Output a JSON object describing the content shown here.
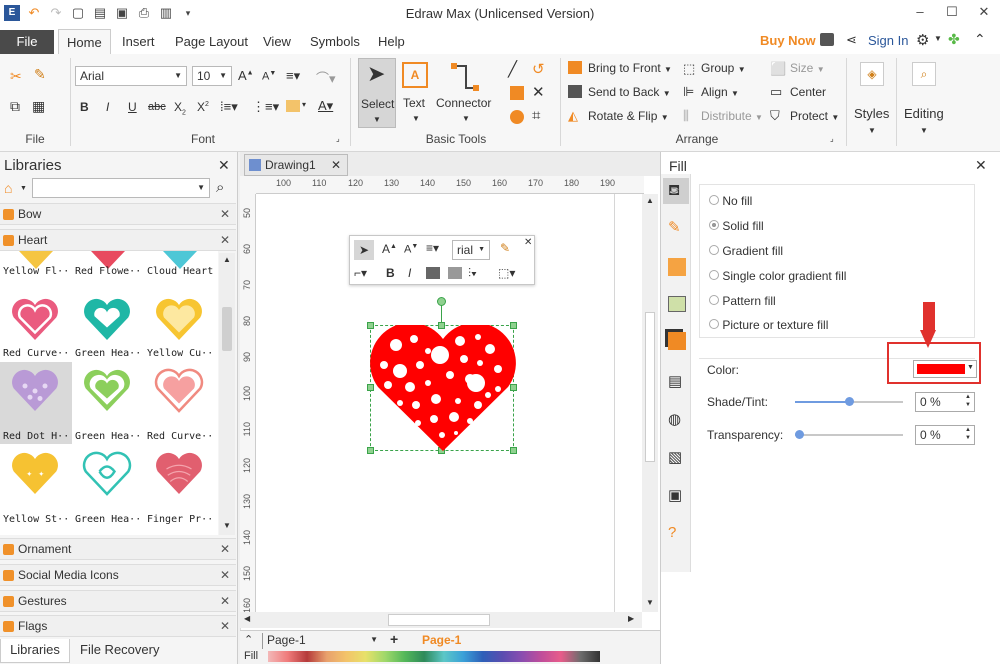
{
  "app": {
    "title": "Edraw Max (Unlicensed Version)"
  },
  "menu": {
    "file": "File",
    "tabs": [
      "Home",
      "Insert",
      "Page Layout",
      "View",
      "Symbols",
      "Help"
    ],
    "buy_now": "Buy Now",
    "sign_in": "Sign In"
  },
  "ribbon": {
    "file_group": "File",
    "font_group": "Font",
    "font_name": "Arial",
    "font_size": "10",
    "basic_tools_group": "Basic Tools",
    "select": "Select",
    "text": "Text",
    "connector": "Connector",
    "arrange_group": "Arrange",
    "bring_to_front": "Bring to Front",
    "send_to_back": "Send to Back",
    "rotate_flip": "Rotate & Flip",
    "group": "Group",
    "align": "Align",
    "distribute": "Distribute",
    "size": "Size",
    "center": "Center",
    "protect": "Protect",
    "styles": "Styles",
    "editing": "Editing"
  },
  "libraries": {
    "title": "Libraries",
    "categories_top": [
      "Bow",
      "Heart"
    ],
    "shapes": [
      "Yellow Fl··",
      "Red Flowe··",
      "Cloud Heart",
      "Red Curve··",
      "Green Hea··",
      "Yellow Cu··",
      "Red Dot H··",
      "Green Hea··",
      "Red Curve··",
      "Yellow St··",
      "Green Hea··",
      "Finger Pr··"
    ],
    "categories_bottom": [
      "Ornament",
      "Social Media Icons",
      "Gestures",
      "Flags"
    ],
    "footer_tabs": [
      "Libraries",
      "File Recovery"
    ]
  },
  "canvas": {
    "doc_tab": "Drawing1",
    "ruler_h": [
      "100",
      "110",
      "120",
      "130",
      "140",
      "150",
      "160",
      "170",
      "180",
      "190"
    ],
    "ruler_v": [
      "50",
      "60",
      "70",
      "80",
      "90",
      "100",
      "110",
      "120",
      "130",
      "140",
      "150",
      "160"
    ],
    "mini_font": "rial"
  },
  "fill": {
    "title": "Fill",
    "options": [
      "No fill",
      "Solid fill",
      "Gradient fill",
      "Single color gradient fill",
      "Pattern fill",
      "Picture or texture fill"
    ],
    "selected": "Solid fill",
    "color_label": "Color:",
    "color_value": "#ff0000",
    "shade_label": "Shade/Tint:",
    "shade_value": "0 %",
    "transparency_label": "Transparency:",
    "transparency_value": "0 %"
  },
  "status": {
    "page_selector": "Page-1",
    "active_page": "Page-1",
    "fill_label": "Fill"
  },
  "colors": {
    "accent": "#f08a24",
    "heart": "#ff0000",
    "highlight_box": "#e0312d"
  }
}
